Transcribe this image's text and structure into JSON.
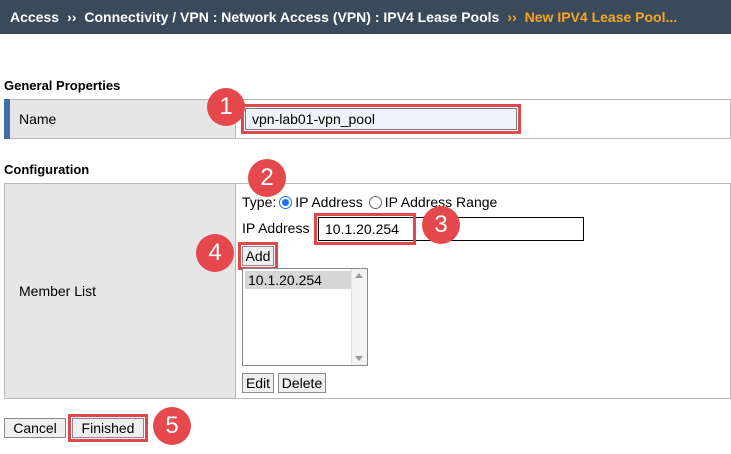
{
  "breadcrumb": {
    "items": [
      "Access",
      "Connectivity / VPN : Network Access (VPN) : IPV4 Lease Pools"
    ],
    "separator": "››",
    "current": "New IPV4 Lease Pool..."
  },
  "general_properties": {
    "title": "General Properties",
    "name_label": "Name",
    "name_value": "vpn-lab01-vpn_pool"
  },
  "configuration": {
    "title": "Configuration",
    "member_list_label": "Member List",
    "type_label": "Type:",
    "type_options": [
      {
        "label": "IP Address",
        "checked": true
      },
      {
        "label": "IP Address Range",
        "checked": false
      }
    ],
    "ip_address_label": "IP Address",
    "ip_address_value": "10.1.20.254",
    "add_button": "Add",
    "members": [
      "10.1.20.254"
    ],
    "edit_button": "Edit",
    "delete_button": "Delete"
  },
  "footer": {
    "cancel_button": "Cancel",
    "finished_button": "Finished"
  },
  "callouts": [
    "1",
    "2",
    "3",
    "4",
    "5"
  ],
  "colors": {
    "header_bg": "#3b4a5a",
    "current_crumb": "#f5a623",
    "callout": "#e5484d",
    "highlight": "#e0484a",
    "marker": "#3f6fa8"
  }
}
